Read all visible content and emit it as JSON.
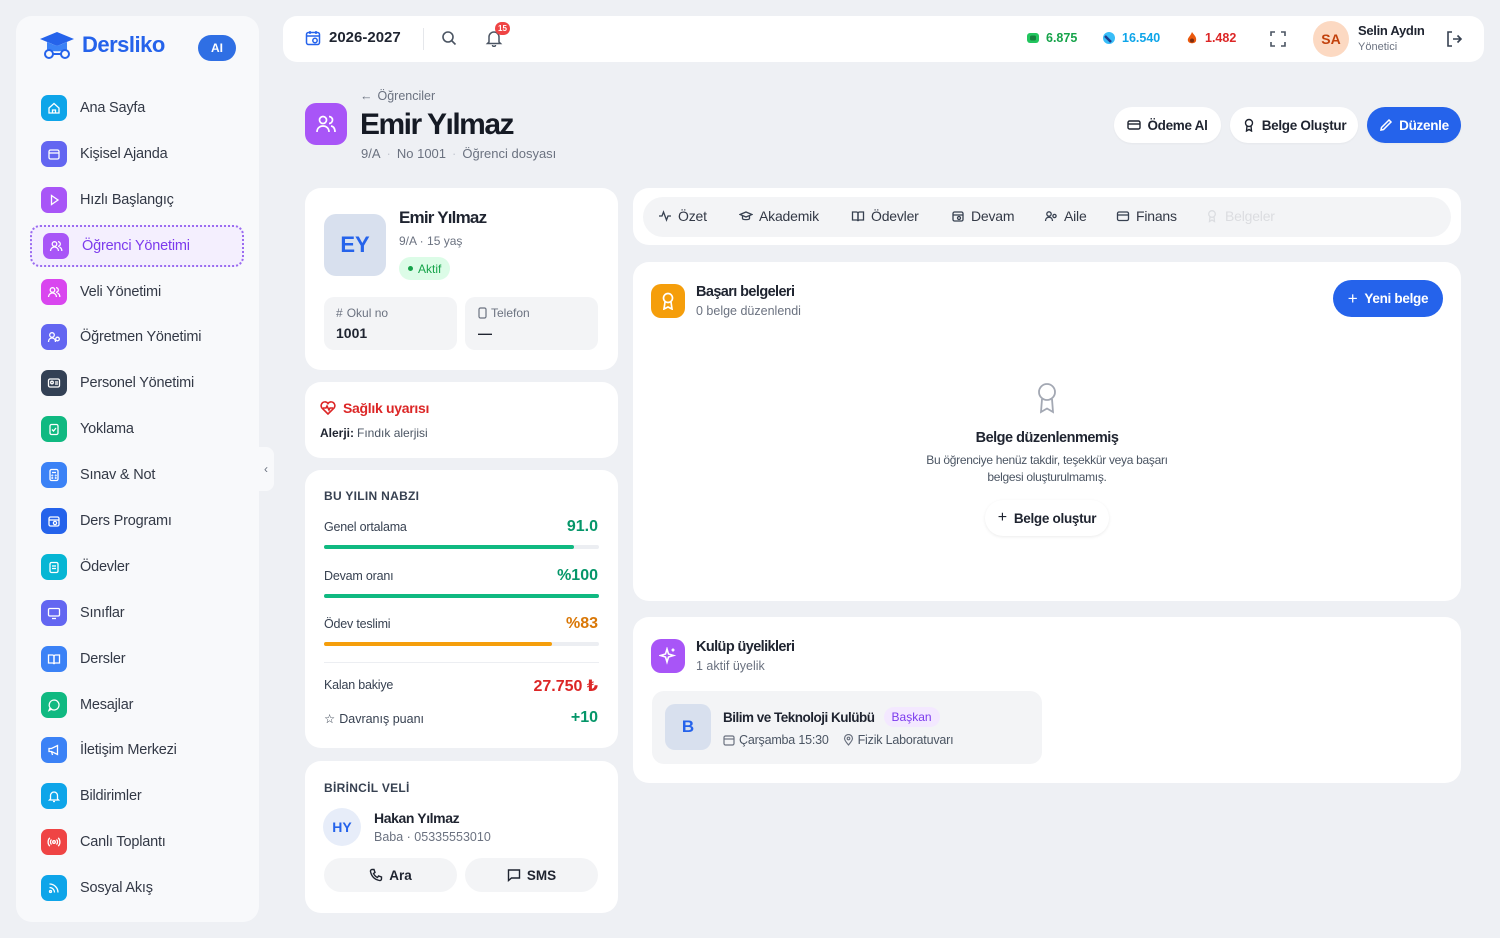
{
  "brand": {
    "name": "Dersliko",
    "ai": "AI"
  },
  "sidebar": {
    "items": [
      {
        "label": "Ana Sayfa",
        "icon": "home-icon",
        "color": "#0ea5e9"
      },
      {
        "label": "Kişisel Ajanda",
        "icon": "calendar-icon",
        "color": "#6366f1"
      },
      {
        "label": "Hızlı Başlangıç",
        "icon": "play-icon",
        "color": "#a855f7"
      },
      {
        "label": "Öğrenci Yönetimi",
        "icon": "users-icon",
        "color": "#a855f7"
      },
      {
        "label": "Veli Yönetimi",
        "icon": "users-icon",
        "color": "#d946ef"
      },
      {
        "label": "Öğretmen Yönetimi",
        "icon": "teacher-icon",
        "color": "#6366f1"
      },
      {
        "label": "Personel Yönetimi",
        "icon": "id-card-icon",
        "color": "#334155"
      },
      {
        "label": "Yoklama",
        "icon": "clipboard-check-icon",
        "color": "#10b981"
      },
      {
        "label": "Sınav & Not",
        "icon": "calculator-icon",
        "color": "#3b82f6"
      },
      {
        "label": "Ders Programı",
        "icon": "schedule-icon",
        "color": "#2563eb"
      },
      {
        "label": "Ödevler",
        "icon": "clipboard-icon",
        "color": "#06b6d4"
      },
      {
        "label": "Sınıflar",
        "icon": "monitor-icon",
        "color": "#6366f1"
      },
      {
        "label": "Dersler",
        "icon": "book-icon",
        "color": "#3b82f6"
      },
      {
        "label": "Mesajlar",
        "icon": "message-icon",
        "color": "#10b981"
      },
      {
        "label": "İletişim Merkezi",
        "icon": "megaphone-icon",
        "color": "#3b82f6"
      },
      {
        "label": "Bildirimler",
        "icon": "bell-icon",
        "color": "#0ea5e9"
      },
      {
        "label": "Canlı Toplantı",
        "icon": "broadcast-icon",
        "color": "#ef4444"
      },
      {
        "label": "Sosyal Akış",
        "icon": "rss-icon",
        "color": "#0ea5e9"
      }
    ]
  },
  "topbar": {
    "year": "2026-2027",
    "notif_count": "15",
    "stats": [
      {
        "value": "6.875",
        "color": "#16a34a",
        "icon": "emerald-icon"
      },
      {
        "value": "16.540",
        "color": "#0ea5e9",
        "icon": "gem-icon"
      },
      {
        "value": "1.482",
        "color": "#dc2626",
        "icon": "flame-icon"
      }
    ],
    "user": {
      "initials": "SA",
      "name": "Selin Aydın",
      "role": "Yönetici"
    }
  },
  "header": {
    "back": "Öğrenciler",
    "title": "Emir Yılmaz",
    "class": "9/A",
    "number": "No 1001",
    "desc": "Öğrenci dosyası"
  },
  "actions": {
    "payment": "Ödeme Al",
    "document": "Belge Oluştur",
    "edit": "Düzenle"
  },
  "profile": {
    "initials": "EY",
    "name": "Emir Yılmaz",
    "meta": "9/A · 15 yaş",
    "status": "Aktif",
    "school_no_label": "Okul no",
    "school_no": "1001",
    "phone_label": "Telefon",
    "phone": "—"
  },
  "health": {
    "title": "Sağlık uyarısı",
    "label": "Alerji:",
    "value": "Fındık alerjisi"
  },
  "pulse": {
    "title": "BU YILIN NABZI",
    "metrics": [
      {
        "label": "Genel ortalama",
        "value": "91.0",
        "fraction": 0.91,
        "color": "#10b981",
        "text_color": "#059669"
      },
      {
        "label": "Devam oranı",
        "value": "%100",
        "fraction": 1.0,
        "color": "#10b981",
        "text_color": "#059669"
      },
      {
        "label": "Ödev teslimi",
        "value": "%83",
        "fraction": 0.83,
        "color": "#f59e0b",
        "text_color": "#d97706"
      }
    ],
    "balance_label": "Kalan bakiye",
    "balance": "27.750 ₺",
    "behavior_label": "Davranış puanı",
    "behavior": "+10"
  },
  "parent": {
    "title": "BİRİNCİL VELİ",
    "initials": "HY",
    "name": "Hakan Yılmaz",
    "meta": "Baba · 05335553010",
    "call": "Ara",
    "sms": "SMS"
  },
  "tabs": [
    {
      "label": "Özet",
      "icon": "pulse-icon"
    },
    {
      "label": "Akademik",
      "icon": "graduation-icon"
    },
    {
      "label": "Ödevler",
      "icon": "book-open-icon"
    },
    {
      "label": "Devam",
      "icon": "calendar-icon"
    },
    {
      "label": "Aile",
      "icon": "family-icon"
    },
    {
      "label": "Finans",
      "icon": "wallet-icon"
    },
    {
      "label": "Belgeler",
      "icon": "award-icon"
    }
  ],
  "certificates": {
    "title": "Başarı belgeleri",
    "subtitle": "0 belge düzenlendi",
    "new_button": "Yeni belge",
    "empty_title": "Belge düzenlenmemiş",
    "empty_line1": "Bu öğrenciye henüz takdir, teşekkür veya başarı",
    "empty_line2": "belgesi oluşturulmamış.",
    "create": "Belge oluştur"
  },
  "clubs": {
    "title": "Kulüp üyelikleri",
    "subtitle": "1 aktif üyelik",
    "club": {
      "initial": "B",
      "name": "Bilim ve Teknoloji Kulübü",
      "role": "Başkan",
      "schedule": "Çarşamba 15:30",
      "location": "Fizik Laboratuvarı"
    }
  }
}
